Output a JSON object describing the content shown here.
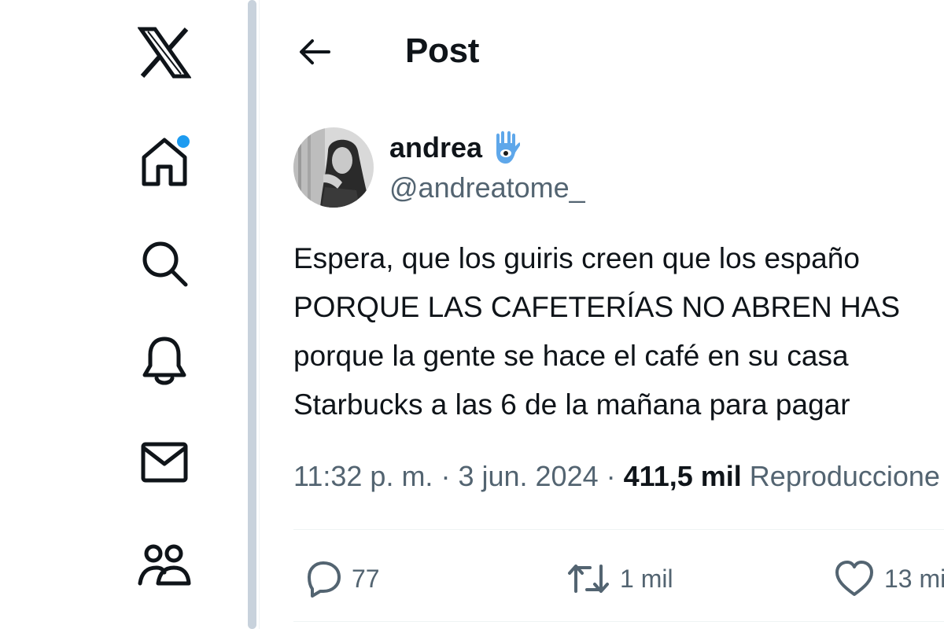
{
  "header": {
    "title": "Post"
  },
  "nav": {
    "items": [
      {
        "name": "x-logo"
      },
      {
        "name": "home",
        "has_notification": true
      },
      {
        "name": "explore"
      },
      {
        "name": "notifications"
      },
      {
        "name": "messages"
      },
      {
        "name": "communities"
      }
    ],
    "accent_color": "#1d9bf0"
  },
  "post": {
    "author": {
      "display_name": "andrea",
      "handle": "@andreatome_",
      "badge_icon": "hamsa-icon"
    },
    "text_lines": [
      "Espera, que los guiris creen que los españo",
      "PORQUE LAS CAFETERÍAS NO ABREN HAS",
      "porque la gente se hace el café en su casa",
      "Starbucks a las 6 de la mañana para pagar"
    ],
    "time": "11:32 p. m.",
    "separator": "·",
    "date": "3 jun. 2024",
    "views_count": "411,5 mil",
    "views_label": "Reproduccione"
  },
  "actions": {
    "replies": "77",
    "reposts": "1 mil",
    "likes": "13 mi"
  }
}
